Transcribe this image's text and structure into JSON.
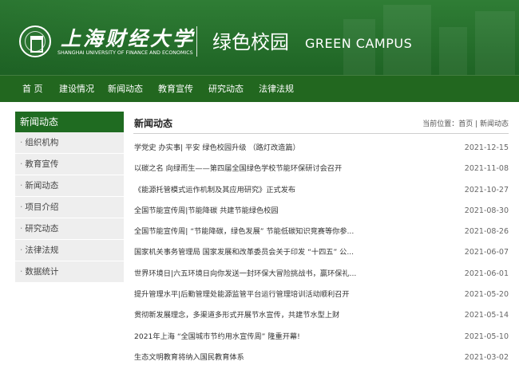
{
  "header": {
    "university_cn": "上海财经大学",
    "university_en": "SHANGHAI UNIVERSITY OF FINANCE AND ECONOMICS",
    "site_title_cn": "绿色校园",
    "site_title_en": "GREEN CAMPUS",
    "brand_color": "#2a7330"
  },
  "nav": {
    "items": [
      "首 页",
      "建设情况",
      "新闻动态",
      "教育宣传",
      "研究动态",
      "法律法规"
    ]
  },
  "sidebar": {
    "title": "新闻动态",
    "items": [
      "组织机构",
      "教育宣传",
      "新闻动态",
      "项目介绍",
      "研究动态",
      "法律法规",
      "数据统计"
    ]
  },
  "main": {
    "title": "新闻动态",
    "breadcrumb": "当前位置：首页 | 新闻动态",
    "news": [
      {
        "title": "学党史 办实事| 平安 绿色校园升级 （路灯改造篇）",
        "date": "2021-12-15"
      },
      {
        "title": "以碳之名 向绿而生——第四届全国绿色学校节能环保研讨会召开",
        "date": "2021-11-08"
      },
      {
        "title": "《能源托管模式运作机制及其应用研究》正式发布",
        "date": "2021-10-27"
      },
      {
        "title": "全国节能宣传周|节能降碳 共建节能绿色校园",
        "date": "2021-08-30"
      },
      {
        "title": "全国节能宣传周| “节能降碳，绿色发展” 节能低碳知识竞赛等你参...",
        "date": "2021-08-26"
      },
      {
        "title": "国家机关事务管理局 国家发展和改革委员会关于印发 “十四五” 公...",
        "date": "2021-06-07"
      },
      {
        "title": "世界环境日|六五环境日向你发送一封环保大冒险挑战书，赢环保礼...",
        "date": "2021-06-01"
      },
      {
        "title": "提升管理水平|后勤管理处能源监管平台运行管理培训活动顺利召开",
        "date": "2021-05-20"
      },
      {
        "title": "贯彻新发展理念，多渠道多形式开展节水宣传，共建节水型上财",
        "date": "2021-05-14"
      },
      {
        "title": "2021年上海 “全国城市节约用水宣传周” 隆重开幕!",
        "date": "2021-05-10"
      },
      {
        "title": "生态文明教育将纳入国民教育体系",
        "date": "2021-03-02"
      }
    ]
  }
}
